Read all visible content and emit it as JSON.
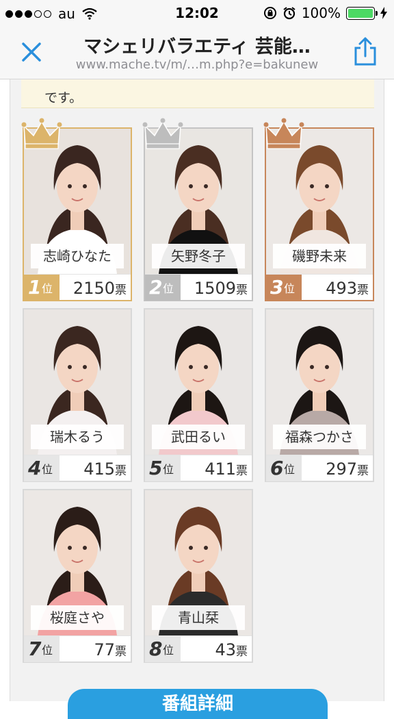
{
  "status_bar": {
    "carrier": "au",
    "time": "12:02",
    "battery": "100%"
  },
  "browser": {
    "title": "マシェリバラエティ 芸能…",
    "url": "www.mache.tv/m/…m.php?e=bakunew",
    "close_icon": "close-icon",
    "share_icon": "share-icon"
  },
  "notice": {
    "text": "です。"
  },
  "ranking": [
    {
      "name": "志崎ひなた",
      "rank": "1",
      "rank_suffix": "位",
      "votes": "2150",
      "unit": "票",
      "tier": "gold",
      "bg": "#e8e2dd",
      "hair": "#3a2620",
      "top": "#ffffff"
    },
    {
      "name": "矢野冬子",
      "rank": "2",
      "rank_suffix": "位",
      "votes": "1509",
      "unit": "票",
      "tier": "silver",
      "bg": "#e9e6e2",
      "hair": "#4a2e22",
      "top": "#111111"
    },
    {
      "name": "磯野未来",
      "rank": "3",
      "rank_suffix": "位",
      "votes": "493",
      "unit": "票",
      "tier": "bronze",
      "bg": "#ece8e5",
      "hair": "#7a4a2c",
      "top": "#f0e6e0"
    },
    {
      "name": "瑞木るう",
      "rank": "4",
      "rank_suffix": "位",
      "votes": "415",
      "unit": "票",
      "tier": "none",
      "bg": "#eae6e3",
      "hair": "#3b2720",
      "top": "#f4f0f0"
    },
    {
      "name": "武田るい",
      "rank": "5",
      "rank_suffix": "位",
      "votes": "411",
      "unit": "票",
      "tier": "none",
      "bg": "#e9e6e4",
      "hair": "#1d1613",
      "top": "#f2c9cc"
    },
    {
      "name": "福森つかさ",
      "rank": "6",
      "rank_suffix": "位",
      "votes": "297",
      "unit": "票",
      "tier": "none",
      "bg": "#ebe8e6",
      "hair": "#1c1614",
      "top": "#b8a9a6"
    },
    {
      "name": "桜庭さや",
      "rank": "7",
      "rank_suffix": "位",
      "votes": "77",
      "unit": "票",
      "tier": "none",
      "bg": "#ece8e5",
      "hair": "#2b1d18",
      "top": "#f2a3a3"
    },
    {
      "name": "青山栞",
      "rank": "8",
      "rank_suffix": "位",
      "votes": "43",
      "unit": "票",
      "tier": "none",
      "bg": "#ebe7e4",
      "hair": "#6a3b25",
      "top": "#2b2b2b"
    }
  ],
  "bottom_button": {
    "label": "番組詳細"
  },
  "colors": {
    "gold": "#dcb46a",
    "silver": "#bdbdbd",
    "bronze": "#c7865a",
    "accent": "#2a9fe0"
  }
}
